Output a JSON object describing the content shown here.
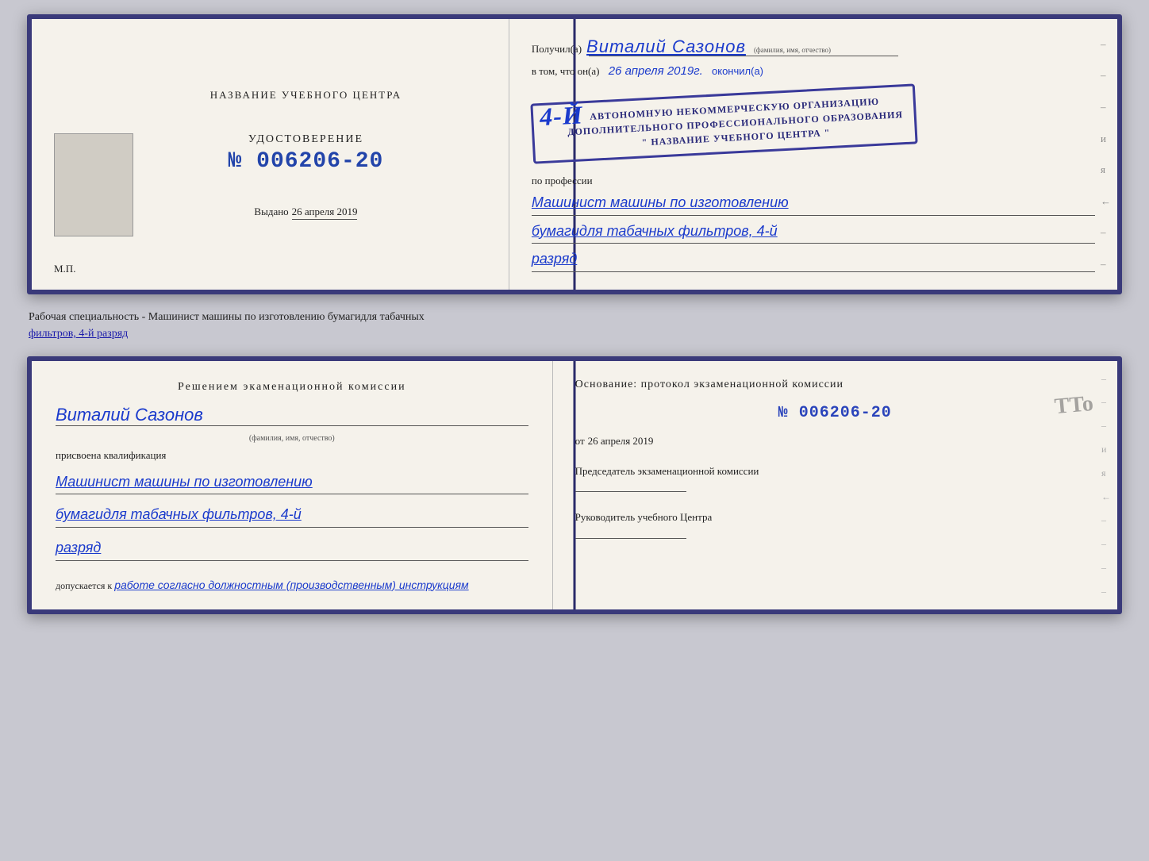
{
  "top": {
    "left": {
      "center_title": "НАЗВАНИЕ УЧЕБНОГО ЦЕНТРА",
      "cert_label": "УДОСТОВЕРЕНИЕ",
      "cert_number": "№ 006206-20",
      "issued_prefix": "Выдано",
      "issued_date": "26 апреля 2019",
      "mp_label": "М.П."
    },
    "right": {
      "recipient_prefix": "Получил(а)",
      "recipient_name": "Виталий Сазонов",
      "recipient_meta": "(фамилия, имя, отчество)",
      "in_that_prefix": "в том, что он(а)",
      "handwritten_date": "26 апреля 2019г.",
      "completed_label": "окончил(а)",
      "stamp_number": "4-й",
      "stamp_line1": "АВТОНОМНУЮ НЕКОММЕРЧЕСКУЮ ОРГАНИЗАЦИЮ",
      "stamp_line2": "ДОПОЛНИТЕЛЬНОГО ПРОФЕССИОНАЛЬНОГО ОБРАЗОВАНИЯ",
      "stamp_line3": "\" НАЗВАНИЕ УЧЕБНОГО ЦЕНТРА \"",
      "profession_label": "по профессии",
      "profession_line1": "Машинист машины по изготовлению",
      "profession_line2": "бумагидля табачных фильтров, 4-й",
      "profession_line3": "разряд"
    }
  },
  "middle": {
    "text": "Рабочая специальность - Машинист машины по изготовлению бумагидля табачных",
    "underline_text": "фильтров, 4-й разряд"
  },
  "bottom": {
    "left": {
      "title": "Решением экаменационной комиссии",
      "name": "Виталий Сазонов",
      "name_meta": "(фамилия, имя, отчество)",
      "qual_prefix": "присвоена квалификация",
      "qual_line1": "Машинист машины по изготовлению",
      "qual_line2": "бумагидля табачных фильтров, 4-й",
      "qual_line3": "разряд",
      "allow_prefix": "допускается к",
      "allow_text": "работе согласно должностным (производственным) инструкциям"
    },
    "right": {
      "basis_label": "Основание: протокол экзаменационной комиссии",
      "basis_number": "№ 006206-20",
      "basis_date_prefix": "от",
      "basis_date": "26 апреля 2019",
      "chairman_label": "Председатель экзаменационной комиссии",
      "head_label": "Руководитель учебного Центра",
      "tto_text": "TTo"
    }
  },
  "dashes": [
    "-",
    "-",
    "-",
    "-",
    "и",
    "я",
    "←",
    "-",
    "-",
    "-",
    "-",
    "-"
  ]
}
